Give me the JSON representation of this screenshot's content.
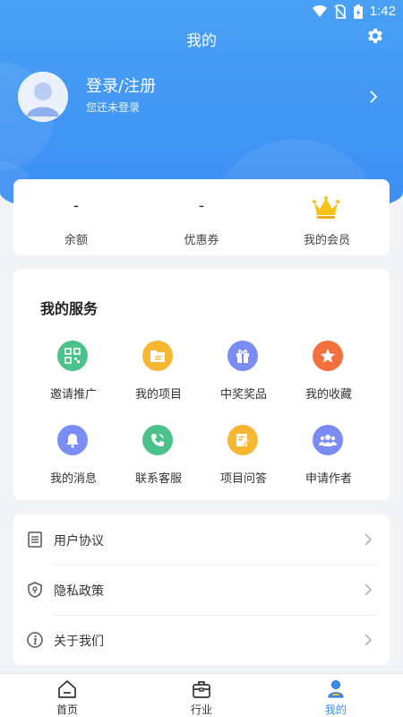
{
  "status_bar": {
    "time": "1:42",
    "icons": [
      "wifi-icon",
      "no-sim-icon",
      "battery-charging-icon"
    ]
  },
  "header": {
    "title": "我的",
    "settings_icon": "gear-icon"
  },
  "profile": {
    "login_label": "登录/注册",
    "subtitle": "您还未登录",
    "avatar_icon": "default-avatar-icon",
    "arrow_icon": "chevron-right-icon"
  },
  "stats": [
    {
      "value": "-",
      "label": "余额"
    },
    {
      "value": "-",
      "label": "优惠券"
    },
    {
      "icon": "crown-icon",
      "label": "我的会员"
    }
  ],
  "services": {
    "title": "我的服务",
    "items": [
      {
        "label": "邀请推广",
        "icon": "qr-code-icon",
        "color": "#4cc28a"
      },
      {
        "label": "我的项目",
        "icon": "folder-icon",
        "color": "#f7b733"
      },
      {
        "label": "中奖奖品",
        "icon": "gift-icon",
        "color": "#7c8cf5"
      },
      {
        "label": "我的收藏",
        "icon": "star-icon",
        "color": "#f5703c"
      },
      {
        "label": "我的消息",
        "icon": "bell-icon",
        "color": "#7c8cf5"
      },
      {
        "label": "联系客服",
        "icon": "phone-icon",
        "color": "#4cc28a"
      },
      {
        "label": "项目问答",
        "icon": "edit-note-icon",
        "color": "#f7b733"
      },
      {
        "label": "申请作者",
        "icon": "group-icon",
        "color": "#7c8cf5"
      }
    ]
  },
  "settings_list": [
    {
      "label": "用户协议",
      "icon": "document-icon"
    },
    {
      "label": "隐私政策",
      "icon": "shield-icon"
    },
    {
      "label": "关于我们",
      "icon": "info-icon"
    }
  ],
  "tabbar": {
    "tabs": [
      {
        "label": "首页",
        "icon": "home-icon",
        "active": false
      },
      {
        "label": "行业",
        "icon": "briefcase-icon",
        "active": false
      },
      {
        "label": "我的",
        "icon": "profile-icon",
        "active": true
      }
    ]
  },
  "colors": {
    "primary": "#3b8ef3",
    "background": "#f2f3f5",
    "crown": "#f7c21c"
  }
}
